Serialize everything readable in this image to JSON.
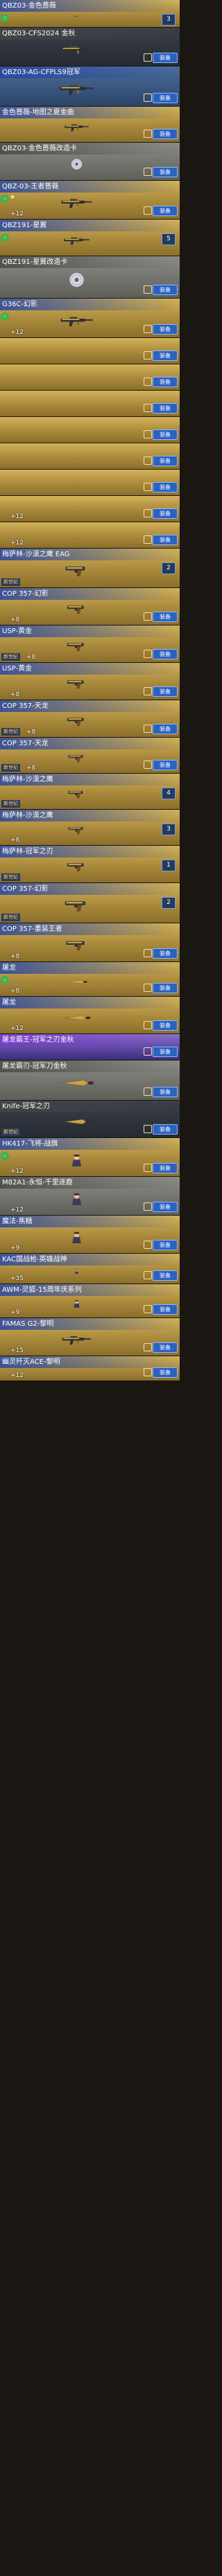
{
  "equip_label": "装备",
  "cards": [
    {
      "title": "QBZ03-金色蔷薇",
      "theme": "gold",
      "h": 40,
      "ctag": "☆",
      "star": "",
      "level": "",
      "tag": "",
      "count": "3",
      "equip": false,
      "gun": "rifle"
    },
    {
      "title": "QBZ03-CFS2024 金秋",
      "theme": "dark",
      "h": 56,
      "ctag": "",
      "star": "",
      "level": "",
      "tag": "",
      "count": "",
      "equip": true,
      "gun": "rifle"
    },
    {
      "title": "QBZ03-AG-CFPLS9冠军",
      "theme": "blue",
      "h": 58,
      "ctag": "",
      "star": "",
      "level": "",
      "tag": "",
      "count": "",
      "equip": true,
      "gun": "rifle"
    },
    {
      "title": "金色蔷薇-地图之夏金曲",
      "theme": "gold",
      "h": 52,
      "ctag": "",
      "star": "",
      "level": "",
      "tag": "",
      "count": "",
      "equip": true,
      "gun": "rifle"
    },
    {
      "title": "QBZ03-金色蔷薇改造卡",
      "theme": "silver",
      "h": 55,
      "ctag": "",
      "star": "",
      "level": "",
      "tag": "",
      "count": "",
      "equip": true,
      "gun": "disc"
    },
    {
      "title": "QBZ-03-王者蔷薇",
      "theme": "gold",
      "h": 56,
      "ctag": "☆",
      "star": "★",
      "level": "+12",
      "tag": "",
      "count": "",
      "equip": true,
      "gun": "rifle"
    },
    {
      "title": "QBZ191-星翼",
      "theme": "gold",
      "h": 53,
      "ctag": "☆",
      "star": "",
      "level": "",
      "tag": "",
      "count": "5",
      "equip": false,
      "gun": "rifle"
    },
    {
      "title": "QBZ191-星翼改造卡",
      "theme": "silver",
      "h": 61,
      "ctag": "",
      "star": "",
      "level": "",
      "tag": "",
      "count": "",
      "equip": true,
      "gun": "disc"
    },
    {
      "title": "G36C-幻影",
      "theme": "gold",
      "h": 57,
      "ctag": "☆",
      "star": "",
      "level": "+12",
      "tag": "",
      "count": "",
      "equip": true,
      "gun": "rifle"
    },
    {
      "title": "",
      "theme": "gold",
      "h": 38,
      "ctag": "",
      "star": "",
      "level": "",
      "tag": "",
      "count": "",
      "equip": true,
      "gun": "rifle"
    },
    {
      "title": "",
      "theme": "gold",
      "h": 38,
      "ctag": "",
      "star": "",
      "level": "",
      "tag": "",
      "count": "",
      "equip": true,
      "gun": "rifle"
    },
    {
      "title": "",
      "theme": "gold",
      "h": 38,
      "ctag": "",
      "star": "",
      "level": "",
      "tag": "",
      "count": "",
      "equip": true,
      "gun": "rifle"
    },
    {
      "title": "",
      "theme": "gold",
      "h": 38,
      "ctag": "",
      "star": "",
      "level": "",
      "tag": "",
      "count": "",
      "equip": true,
      "gun": "rifle"
    },
    {
      "title": "",
      "theme": "gold",
      "h": 38,
      "ctag": "",
      "star": "",
      "level": "",
      "tag": "",
      "count": "",
      "equip": true,
      "gun": "rifle"
    },
    {
      "title": "",
      "theme": "gold",
      "h": 38,
      "ctag": "",
      "star": "",
      "level": "",
      "tag": "",
      "count": "",
      "equip": true,
      "gun": "rifle"
    },
    {
      "title": "",
      "theme": "gold",
      "h": 38,
      "ctag": "",
      "star": "",
      "level": "+12",
      "tag": "",
      "count": "",
      "equip": true,
      "gun": "rifle"
    },
    {
      "title": "",
      "theme": "gold",
      "h": 38,
      "ctag": "",
      "star": "",
      "level": "+12",
      "tag": "",
      "count": "",
      "equip": true,
      "gun": "rifle"
    },
    {
      "title": "梅萨林-沙漠之鹰 EAG",
      "theme": "gold",
      "h": 57,
      "ctag": "",
      "star": "",
      "level": "",
      "tag": "新世纪",
      "count": "2",
      "equip": false,
      "gun": "pistol"
    },
    {
      "title": "COP 357-幻影",
      "theme": "gold",
      "h": 54,
      "ctag": "",
      "star": "",
      "level": "+8",
      "tag": "",
      "count": "",
      "equip": true,
      "gun": "pistol"
    },
    {
      "title": "USP-黄金",
      "theme": "gold",
      "h": 54,
      "ctag": "",
      "star": "",
      "level": "+8",
      "tag": "新世纪",
      "count": "",
      "equip": true,
      "gun": "pistol"
    },
    {
      "title": "USP-黄金",
      "theme": "gold",
      "h": 54,
      "ctag": "",
      "star": "",
      "level": "+8",
      "tag": "",
      "count": "",
      "equip": true,
      "gun": "pistol"
    },
    {
      "title": "COP 357-天龙",
      "theme": "gold",
      "h": 54,
      "ctag": "",
      "star": "",
      "level": "+8",
      "tag": "新世纪",
      "count": "",
      "equip": true,
      "gun": "pistol"
    },
    {
      "title": "COP 357-天龙",
      "theme": "gold",
      "h": 52,
      "ctag": "",
      "star": "",
      "level": "+8",
      "tag": "新世纪",
      "count": "",
      "equip": true,
      "gun": "pistol"
    },
    {
      "title": "梅萨林-沙漠之鹰",
      "theme": "gold",
      "h": 52,
      "ctag": "",
      "star": "",
      "level": "",
      "tag": "新世纪",
      "count": "4",
      "equip": false,
      "gun": "pistol"
    },
    {
      "title": "梅萨林-沙漠之鹰",
      "theme": "gold",
      "h": 52,
      "ctag": "",
      "star": "",
      "level": "+8",
      "tag": "",
      "count": "3",
      "equip": false,
      "gun": "pistol"
    },
    {
      "title": "梅萨林-冠军之刃",
      "theme": "gold",
      "h": 54,
      "ctag": "",
      "star": "",
      "level": "",
      "tag": "新世纪",
      "count": "1",
      "equip": false,
      "gun": "pistol"
    },
    {
      "title": "COP 357-幻影",
      "theme": "gold",
      "h": 58,
      "ctag": "",
      "star": "",
      "level": "",
      "tag": "新世纪",
      "count": "2",
      "equip": false,
      "gun": "pistol"
    },
    {
      "title": "COP 357-重装王者",
      "theme": "gold",
      "h": 56,
      "ctag": "",
      "star": "",
      "level": "+8",
      "tag": "",
      "count": "",
      "equip": true,
      "gun": "pistol"
    },
    {
      "title": "屠龙",
      "theme": "gold",
      "h": 50,
      "ctag": "☆",
      "star": "",
      "level": "+8",
      "tag": "",
      "count": "",
      "equip": true,
      "gun": "knife"
    },
    {
      "title": "屠龙",
      "theme": "gold",
      "h": 54,
      "ctag": "",
      "star": "",
      "level": "+12",
      "tag": "",
      "count": "",
      "equip": true,
      "gun": "knife"
    },
    {
      "title": "屠龙霸王-冠军之刃金秋",
      "theme": "purple",
      "h": 38,
      "ctag": "",
      "star": "",
      "level": "",
      "tag": "",
      "count": "",
      "equip": true,
      "gun": "knife"
    },
    {
      "title": "屠龙霸刃-冠军刀金秋",
      "theme": "silver",
      "h": 58,
      "ctag": "",
      "star": "",
      "level": "",
      "tag": "",
      "count": "",
      "equip": true,
      "gun": "knife"
    },
    {
      "title": "Knife-冠军之刃",
      "theme": "dark",
      "h": 54,
      "ctag": "",
      "star": "",
      "level": "",
      "tag": "新世纪",
      "count": "",
      "equip": true,
      "gun": "knife"
    },
    {
      "title": "HK417-飞将-战旗",
      "theme": "gold",
      "h": 56,
      "ctag": "☆",
      "star": "",
      "level": "+12",
      "tag": "",
      "count": "",
      "equip": true,
      "gun": "char"
    },
    {
      "title": "M82A1-永恒-千里逐鹿",
      "theme": "silver",
      "h": 56,
      "ctag": "",
      "star": "",
      "level": "+12",
      "tag": "",
      "count": "",
      "equip": true,
      "gun": "char"
    },
    {
      "title": "魔法-焦糖",
      "theme": "gold",
      "h": 55,
      "ctag": "",
      "star": "",
      "level": "+9",
      "tag": "",
      "count": "",
      "equip": true,
      "gun": "char"
    },
    {
      "title": "KAC国战枪-英雄战神",
      "theme": "gold",
      "h": 44,
      "ctag": "",
      "star": "",
      "level": "+35",
      "tag": "",
      "count": "",
      "equip": true,
      "gun": "char"
    },
    {
      "title": "AWM-灵狐-15周年庆系列",
      "theme": "gold",
      "h": 49,
      "ctag": "",
      "star": "",
      "level": "+9",
      "tag": "",
      "count": "",
      "equip": true,
      "gun": "char"
    },
    {
      "title": "FAMAS G2-黎明",
      "theme": "gold",
      "h": 55,
      "ctag": "",
      "star": "",
      "level": "+15",
      "tag": "",
      "count": "",
      "equip": true,
      "gun": "rifle"
    },
    {
      "title": "幽灵歼灭ACE-黎明",
      "theme": "gold",
      "h": 36,
      "ctag": "",
      "star": "",
      "level": "+12",
      "tag": "",
      "count": "",
      "equip": true,
      "gun": "rifle"
    }
  ]
}
